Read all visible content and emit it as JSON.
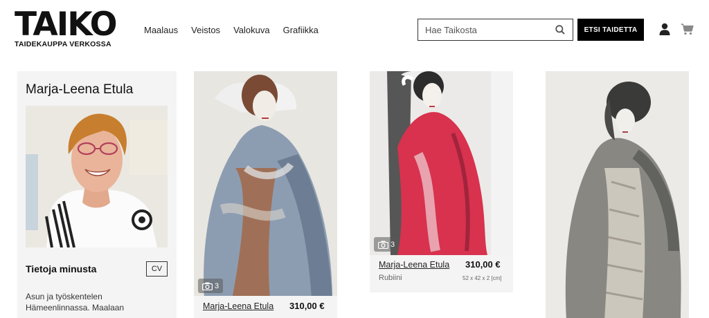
{
  "header": {
    "logo_word": "TAIKO",
    "logo_sub": "TAIDEKAUPPA VERKOSSA",
    "nav": [
      "Maalaus",
      "Veistos",
      "Valokuva",
      "Grafiikka"
    ],
    "search_placeholder": "Hae Taikosta",
    "search_button": "ETSI TAIDETTA",
    "icons": [
      "search-icon",
      "user-icon",
      "cart-icon"
    ]
  },
  "artist": {
    "name": "Marja-Leena Etula",
    "about_title": "Tietoja minusta",
    "cv_label": "CV",
    "about_text": "Asun ja työskentelen Hämeenlinnassa. Maalaan"
  },
  "products": [
    {
      "photo_count": "3",
      "artist": "Marja-Leena Etula",
      "price": "310,00 €"
    },
    {
      "photo_count": "3",
      "artist": "Marja-Leena Etula",
      "price": "310,00 €",
      "title": "Rubiini",
      "dims": "52 x 42 x 2 [cm]"
    },
    {}
  ],
  "colors": {
    "accent": "#000000",
    "card_bg": "#f4f4f4",
    "text": "#1a1a1a"
  }
}
